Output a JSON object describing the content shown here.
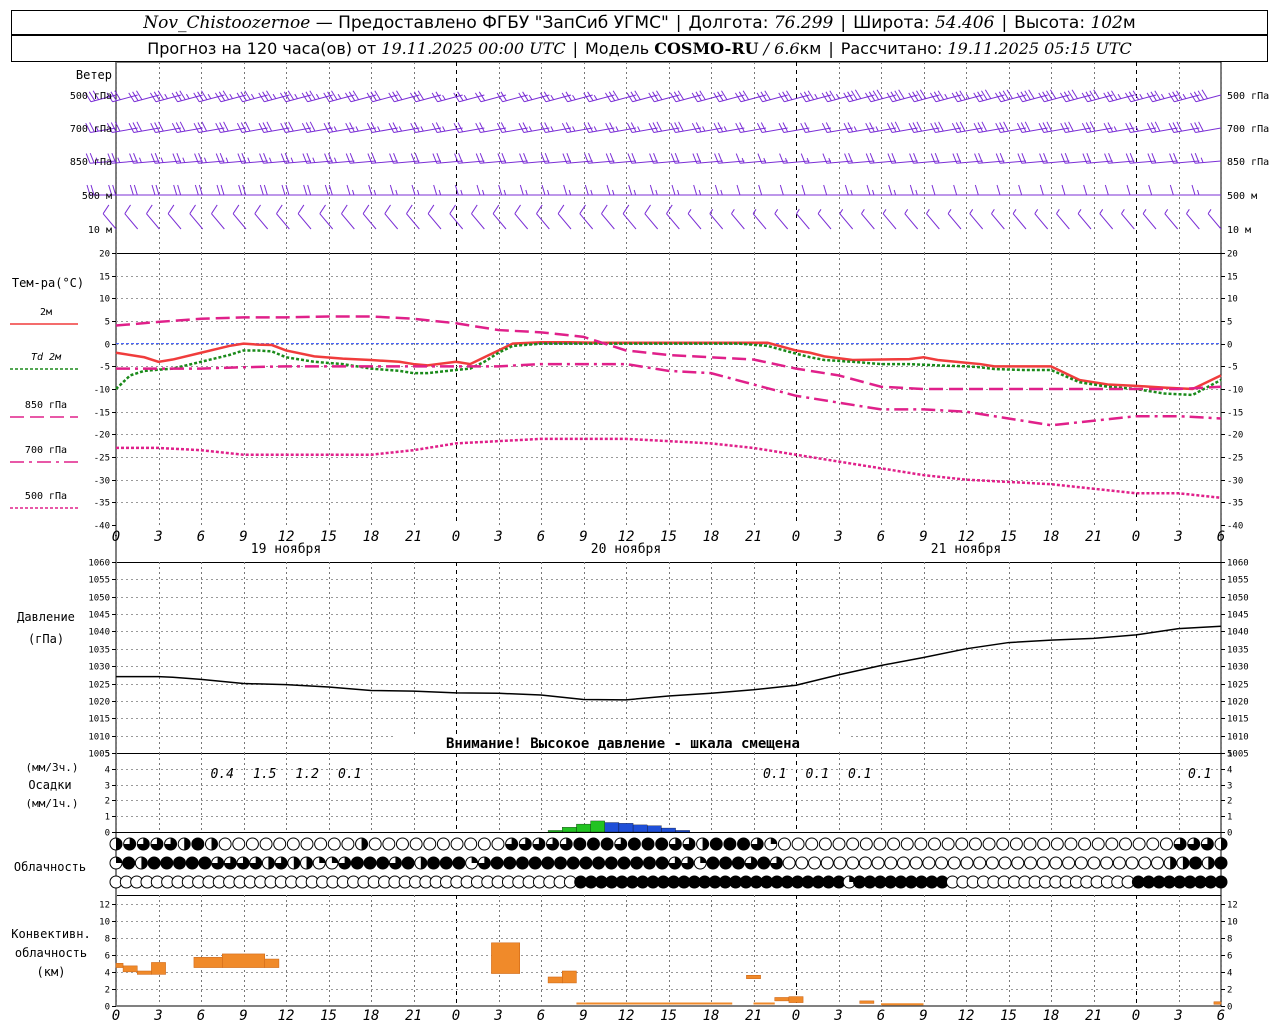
{
  "header": {
    "station": "Nov_Chistoozernoe",
    "provider": "— Предоставлено ФГБУ \"ЗапСиб УГМС\"",
    "lon_label": "Долгота:",
    "lon_value": "76.299",
    "lat_label": "Широта:",
    "lat_value": "54.406",
    "alt_label": "Высота:",
    "alt_value": "102",
    "alt_unit": "м",
    "forecast_label": "Прогноз на 120 часа(ов) от",
    "forecast_start": "19.11.2025 00:00 UTC",
    "model_label": "Модель",
    "model_name": "COSMO-RU",
    "model_res": "/ 6.6",
    "model_res_unit": "км",
    "calc_label": "Рассчитано:",
    "calc_time": "19.11.2025 05:15 UTC"
  },
  "labels": {
    "wind": "Ветер",
    "wind_levels": [
      "500 гПа",
      "700 гПа",
      "850 гПа",
      "500 м",
      "10 м"
    ],
    "temp_title": "Тем-ра(°C)",
    "temp_legend": [
      "2м",
      "Td  2м",
      "850 гПа",
      "700 гПа",
      "500 гПа"
    ],
    "pressure_title": "Давление",
    "pressure_unit": "(гПа)",
    "pressure_warning": "Внимание! Высокое давление - шкала смещена",
    "precip_unit_top": "(мм/3ч.)",
    "precip_title": "Осадки",
    "precip_unit_bottom": "(мм/1ч.)",
    "cloud_title": "Облачность",
    "conv_title": [
      "Конвективн.",
      "облачность",
      "(км)"
    ],
    "day_labels": [
      "19 ноября",
      "20 ноября",
      "21 ноября"
    ]
  },
  "colors": {
    "wind": "#7b2fd6",
    "t2m": "#f03c3c",
    "td2m": "#1a8a1a",
    "t850": "#e0208a",
    "t700": "#e0208a",
    "t500": "#e0208a",
    "pressure": "#000000",
    "precip_rain": "#22c322",
    "precip_mixed": "#1f4fd8",
    "conv": "#f08a2a",
    "zero_line": "#3050ff"
  },
  "chart_data": [
    {
      "type": "line",
      "title": "Тем-ра(°C)",
      "x_hours": [
        0,
        3,
        6,
        9,
        12,
        15,
        18,
        21,
        24,
        27,
        30,
        33,
        36,
        39,
        42,
        45,
        48,
        51,
        54,
        57,
        60,
        63,
        66,
        69,
        72,
        75,
        78
      ],
      "x_tick_labels": [
        "0",
        "3",
        "6",
        "9",
        "12",
        "15",
        "18",
        "21",
        "0",
        "3",
        "6",
        "9",
        "12",
        "15",
        "18",
        "21",
        "0",
        "3",
        "6",
        "9",
        "12",
        "15",
        "18",
        "21",
        "0",
        "3",
        "6"
      ],
      "ylim": [
        -40,
        20
      ],
      "yticks": [
        -40,
        -35,
        -30,
        -25,
        -20,
        -15,
        -10,
        -5,
        0,
        5,
        10,
        15,
        20
      ],
      "series": [
        {
          "name": "2м",
          "x": [
            0,
            2,
            3,
            4,
            6,
            8,
            9,
            10,
            11,
            12,
            14,
            16,
            18,
            20,
            21,
            22,
            24,
            25,
            26,
            27,
            28,
            30,
            32,
            34,
            36,
            38,
            40,
            42,
            44,
            46,
            48,
            49,
            50,
            52,
            54,
            56,
            57,
            58,
            60,
            61,
            62,
            64,
            66,
            68,
            69,
            70,
            72,
            73,
            74,
            76,
            78
          ],
          "y": [
            -2,
            -3,
            -4,
            -3.5,
            -2,
            -0.5,
            0,
            -0.2,
            -0.3,
            -1.5,
            -2.8,
            -3.3,
            -3.6,
            -4,
            -4.5,
            -4.8,
            -4,
            -4.5,
            -3,
            -1.5,
            0,
            0.3,
            0.3,
            0.2,
            0.2,
            0.2,
            0.2,
            0.2,
            0.2,
            0.2,
            -1.5,
            -2,
            -2.8,
            -3.6,
            -3.5,
            -3.4,
            -3,
            -3.6,
            -4.2,
            -4.5,
            -5,
            -5,
            -5,
            -8,
            -8.5,
            -9,
            -9.3,
            -9.5,
            -9.7,
            -10,
            -7
          ]
        },
        {
          "name": "Td  2м",
          "x": [
            0,
            1,
            2,
            4,
            6,
            8,
            9,
            10,
            11,
            12,
            14,
            16,
            18,
            20,
            21,
            22,
            24,
            25,
            26,
            27,
            28,
            30,
            32,
            34,
            36,
            38,
            40,
            42,
            44,
            46,
            48,
            49,
            50,
            52,
            54,
            56,
            58,
            60,
            61,
            62,
            64,
            66,
            68,
            69,
            70,
            72,
            73,
            74,
            76,
            78
          ],
          "y": [
            -10,
            -7,
            -6,
            -5.5,
            -4,
            -2.5,
            -1.5,
            -1.5,
            -1.7,
            -3,
            -4,
            -4.5,
            -5.5,
            -6,
            -6.5,
            -6.5,
            -5.8,
            -5.5,
            -4,
            -2,
            -0.5,
            0,
            0,
            0,
            0,
            0,
            0,
            0,
            0,
            -0.5,
            -2.2,
            -3,
            -3.6,
            -4,
            -4.5,
            -4.5,
            -4.8,
            -5,
            -5.2,
            -5.6,
            -5.8,
            -5.8,
            -8.5,
            -9,
            -9.5,
            -10,
            -10.5,
            -11,
            -11.3,
            -8
          ]
        },
        {
          "name": "850 гПа",
          "x": [
            0,
            3,
            6,
            9,
            12,
            15,
            18,
            21,
            24,
            27,
            30,
            33,
            36,
            39,
            42,
            45,
            48,
            51,
            54,
            57,
            60,
            63,
            66,
            69,
            72,
            75,
            78
          ],
          "y": [
            4,
            4.8,
            5.5,
            5.8,
            5.8,
            6,
            6,
            5.5,
            4.5,
            3,
            2.5,
            1.5,
            -1.5,
            -2.5,
            -3,
            -3.5,
            -5.5,
            -7,
            -9.5,
            -10,
            -10,
            -10,
            -10,
            -10,
            -10,
            -10,
            -9.5
          ]
        },
        {
          "name": "700 гПа",
          "x": [
            0,
            3,
            6,
            9,
            12,
            15,
            18,
            21,
            24,
            27,
            30,
            33,
            36,
            39,
            42,
            45,
            48,
            51,
            54,
            57,
            60,
            63,
            66,
            69,
            72,
            75,
            78
          ],
          "y": [
            -5.5,
            -5.5,
            -5.5,
            -5.2,
            -5,
            -5,
            -5,
            -5,
            -5,
            -5,
            -4.5,
            -4.5,
            -4.5,
            -6,
            -6.5,
            -9,
            -11.5,
            -13,
            -14.5,
            -14.5,
            -15,
            -16.5,
            -18,
            -17,
            -16,
            -16,
            -16.5
          ]
        },
        {
          "name": "500 гПа",
          "x": [
            0,
            3,
            6,
            9,
            12,
            15,
            18,
            21,
            24,
            27,
            30,
            33,
            36,
            39,
            42,
            45,
            48,
            51,
            54,
            57,
            60,
            63,
            66,
            69,
            72,
            75,
            78
          ],
          "y": [
            -23,
            -23,
            -23.5,
            -24.5,
            -24.5,
            -24.5,
            -24.5,
            -23.5,
            -22,
            -21.5,
            -21,
            -21,
            -21,
            -21.5,
            -22,
            -23,
            -24.5,
            -26,
            -27.5,
            -29,
            -30,
            -30.5,
            -31,
            -32,
            -33,
            -33,
            -34
          ]
        }
      ]
    },
    {
      "type": "line",
      "title": "Давление",
      "ylim": [
        1005,
        1060
      ],
      "yticks": [
        1005,
        1010,
        1015,
        1020,
        1025,
        1030,
        1035,
        1040,
        1045,
        1050,
        1055,
        1060
      ],
      "series": [
        {
          "name": "Давление",
          "x": [
            0,
            3,
            4,
            6,
            9,
            12,
            15,
            18,
            21,
            24,
            27,
            30,
            33,
            36,
            39,
            42,
            45,
            48,
            51,
            54,
            57,
            60,
            63,
            66,
            69,
            72,
            75,
            78
          ],
          "y": [
            1027,
            1027,
            1026.8,
            1026.2,
            1025,
            1024.7,
            1024,
            1023,
            1022.8,
            1022.3,
            1022.2,
            1021.7,
            1020.4,
            1020.3,
            1021.4,
            1022.2,
            1023.2,
            1024.5,
            1027.5,
            1030.2,
            1032.5,
            1035,
            1036.8,
            1037.5,
            1038,
            1039,
            1040.8,
            1041.5
          ]
        }
      ]
    },
    {
      "type": "bar",
      "title": "Осадки",
      "ylim": [
        0,
        5
      ],
      "yticks": [
        0,
        1,
        2,
        3,
        4,
        5
      ],
      "labels": [
        {
          "x": 7.5,
          "text": "0.4"
        },
        {
          "x": 10.5,
          "text": "1.5"
        },
        {
          "x": 13.5,
          "text": "1.2"
        },
        {
          "x": 16.5,
          "text": "0.1"
        },
        {
          "x": 46.5,
          "text": "0.1"
        },
        {
          "x": 49.5,
          "text": "0.1"
        },
        {
          "x": 52.5,
          "text": "0.1"
        },
        {
          "x": 76.5,
          "text": "0.1"
        }
      ],
      "bars_rain": [
        {
          "x": 31,
          "v": 0.1
        },
        {
          "x": 32,
          "v": 0.3
        },
        {
          "x": 33,
          "v": 0.5
        },
        {
          "x": 34,
          "v": 0.7
        }
      ],
      "bars_mixed": [
        {
          "x": 35,
          "v": 0.6
        },
        {
          "x": 36,
          "v": 0.55
        },
        {
          "x": 37,
          "v": 0.45
        },
        {
          "x": 38,
          "v": 0.4
        },
        {
          "x": 39,
          "v": 0.25
        },
        {
          "x": 40,
          "v": 0.1
        }
      ]
    },
    {
      "type": "bar",
      "title": "Конвективн. облачность (км)",
      "ylim": [
        0,
        13
      ],
      "yticks": [
        0,
        2,
        4,
        6,
        8,
        10,
        12
      ],
      "blocks": [
        {
          "x0": 0,
          "x1": 0.5,
          "bottom": 4.5,
          "top": 5
        },
        {
          "x0": 0.5,
          "x1": 1.5,
          "bottom": 4,
          "top": 4.7
        },
        {
          "x0": 1.5,
          "x1": 2.5,
          "bottom": 3.7,
          "top": 4.1
        },
        {
          "x0": 2.5,
          "x1": 3.5,
          "bottom": 3.7,
          "top": 5.1
        },
        {
          "x0": 5.5,
          "x1": 7.5,
          "bottom": 4.5,
          "top": 5.7
        },
        {
          "x0": 7.5,
          "x1": 10.5,
          "bottom": 4.5,
          "top": 6.1
        },
        {
          "x0": 10.5,
          "x1": 11.5,
          "bottom": 4.5,
          "top": 5.5
        },
        {
          "x0": 26.5,
          "x1": 28.5,
          "bottom": 3.8,
          "top": 7.4
        },
        {
          "x0": 30.5,
          "x1": 31.5,
          "bottom": 2.7,
          "top": 3.4
        },
        {
          "x0": 31.5,
          "x1": 32.5,
          "bottom": 2.7,
          "top": 4.1
        },
        {
          "x0": 44.5,
          "x1": 45.5,
          "bottom": 3.2,
          "top": 3.6
        },
        {
          "x0": 46.5,
          "x1": 47.5,
          "bottom": 0.6,
          "top": 1.0
        },
        {
          "x0": 47.5,
          "x1": 48.5,
          "bottom": 0.4,
          "top": 1.1
        },
        {
          "x0": 52.5,
          "x1": 53.5,
          "bottom": 0.3,
          "top": 0.6
        },
        {
          "x0": 77.5,
          "x1": 78,
          "bottom": 0.2,
          "top": 0.5
        }
      ],
      "thin_line": [
        {
          "x0": 32.5,
          "x1": 43.5,
          "top": 0.3
        },
        {
          "x0": 45,
          "x1": 46.5,
          "top": 0.3
        },
        {
          "x0": 54,
          "x1": 57,
          "top": 0.2
        }
      ]
    }
  ],
  "cloud_rows": {
    "upper": "2333324200000000002000000000033333444344433244431000000000000000000000000000003332",
    "middle": "1424444433332322113444342444134444444444444433144434300000000000000000000000000000022424",
    "lower": "000000000000000000000000000000000000000000000444444444444444444444444441444444444000000000000000000444444444"
  },
  "wind_barbs": {
    "levels": [
      {
        "deg": 255,
        "spd": [
          30,
          32,
          34,
          35,
          36,
          37,
          38,
          38,
          38,
          37,
          36,
          35,
          34,
          33,
          32,
          30,
          28,
          26,
          24,
          24,
          25,
          26,
          27,
          28,
          30,
          32,
          34,
          34,
          32,
          30,
          30,
          30,
          32,
          35,
          38,
          40,
          42,
          42,
          40,
          38,
          38,
          40,
          42,
          44,
          44,
          42,
          40,
          38,
          36,
          36,
          38,
          40
        ]
      },
      {
        "deg": 260,
        "spd": [
          28,
          30,
          32,
          33,
          34,
          34,
          34,
          34,
          33,
          32,
          30,
          29,
          28,
          28,
          27,
          26,
          25,
          24,
          24,
          24,
          25,
          26,
          26,
          27,
          28,
          29,
          30,
          30,
          28,
          26,
          24,
          22,
          22,
          22,
          24,
          26,
          28,
          30,
          32,
          32,
          30,
          30,
          32,
          34,
          34,
          32,
          30,
          28,
          28,
          30,
          32,
          34
        ]
      },
      {
        "deg": 265,
        "spd": [
          25,
          26,
          26,
          27,
          28,
          28,
          28,
          28,
          27,
          26,
          26,
          25,
          24,
          24,
          23,
          22,
          22,
          21,
          20,
          20,
          21,
          22,
          22,
          23,
          24,
          24,
          24,
          23,
          22,
          20,
          18,
          16,
          16,
          16,
          18,
          20,
          22,
          22,
          22,
          22,
          22,
          24,
          24,
          24,
          24,
          22,
          22,
          22,
          22,
          22,
          24,
          26
        ]
      },
      {
        "deg": 270,
        "spd": [
          20,
          20,
          22,
          22,
          22,
          22,
          22,
          22,
          20,
          20,
          20,
          20,
          18,
          18,
          18,
          16,
          16,
          16,
          16,
          16,
          16,
          16,
          16,
          16,
          18,
          18,
          16,
          16,
          16,
          16,
          14,
          14,
          14,
          14,
          14,
          16,
          16,
          16,
          16,
          14,
          14,
          14,
          14,
          14,
          14,
          14,
          14,
          14,
          14,
          14,
          14,
          16
        ]
      },
      {
        "deg": 320,
        "spd": [
          10,
          10,
          10,
          10,
          10,
          10,
          10,
          10,
          10,
          10,
          10,
          10,
          10,
          10,
          10,
          10,
          10,
          10,
          10,
          10,
          10,
          10,
          10,
          10,
          10,
          10,
          10,
          8,
          8,
          8,
          8,
          8,
          8,
          8,
          8,
          8,
          8,
          8,
          8,
          8,
          8,
          8,
          8,
          8,
          8,
          8,
          8,
          8,
          8,
          8,
          8,
          8
        ]
      }
    ]
  }
}
